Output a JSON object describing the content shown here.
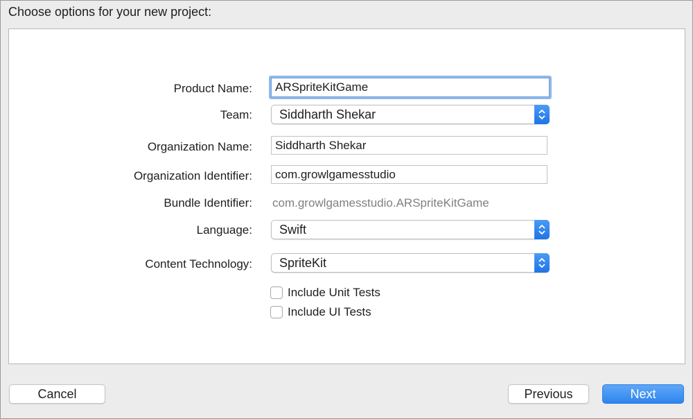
{
  "dialog": {
    "heading": "Choose options for your new project:"
  },
  "form": {
    "product_name": {
      "label": "Product Name:",
      "value": "ARSpriteKitGame"
    },
    "team": {
      "label": "Team:",
      "value": "Siddharth Shekar"
    },
    "organization_name": {
      "label": "Organization Name:",
      "value": "Siddharth Shekar"
    },
    "organization_identifier": {
      "label": "Organization Identifier:",
      "value": "com.growlgamesstudio"
    },
    "bundle_identifier": {
      "label": "Bundle Identifier:",
      "value": "com.growlgamesstudio.ARSpriteKitGame"
    },
    "language": {
      "label": "Language:",
      "value": "Swift"
    },
    "content_technology": {
      "label": "Content Technology:",
      "value": "SpriteKit"
    },
    "include_unit_tests": {
      "label": "Include Unit Tests",
      "checked": false
    },
    "include_ui_tests": {
      "label": "Include UI Tests",
      "checked": false
    }
  },
  "buttons": {
    "cancel": "Cancel",
    "previous": "Previous",
    "next": "Next"
  },
  "colors": {
    "accent": "#2f84ee",
    "focus_ring": "#8fb9ea"
  },
  "icons": {
    "popup_stepper": "up-down-chevron-icon"
  }
}
